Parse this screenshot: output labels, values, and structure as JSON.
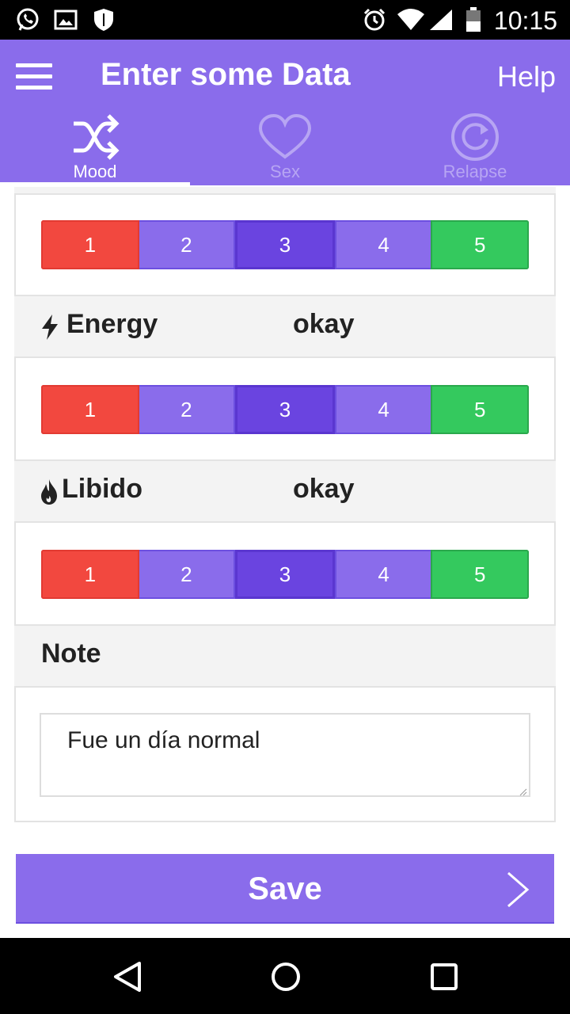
{
  "status_bar": {
    "time": "10:15",
    "icons": [
      "whatsapp-icon",
      "image-icon",
      "shield-icon",
      "alarm-icon",
      "wifi-icon",
      "signal-icon",
      "battery-icon"
    ]
  },
  "app_bar": {
    "title": "Enter some Data",
    "help": "Help",
    "menu_icon": "hamburger-menu-icon"
  },
  "tabs": [
    {
      "label": "Mood",
      "icon": "shuffle-icon",
      "active": true
    },
    {
      "label": "Sex",
      "icon": "heart-icon",
      "active": false
    },
    {
      "label": "Relapse",
      "icon": "refresh-icon",
      "active": false
    }
  ],
  "scales": [
    {
      "options": [
        "1",
        "2",
        "3",
        "4",
        "5"
      ],
      "selected": "3"
    },
    {
      "options": [
        "1",
        "2",
        "3",
        "4",
        "5"
      ],
      "selected": "3"
    },
    {
      "options": [
        "1",
        "2",
        "3",
        "4",
        "5"
      ],
      "selected": "3"
    }
  ],
  "energy": {
    "label": "Energy",
    "value": "okay",
    "icon": "lightning-icon"
  },
  "libido": {
    "label": "Libido",
    "value": "okay",
    "icon": "flame-icon"
  },
  "note": {
    "label": "Note",
    "value": "Fue un día normal"
  },
  "save": {
    "label": "Save",
    "icon": "chevron-right-icon"
  },
  "colors": {
    "accent": "#8a6ceb",
    "selected": "#6a44e0",
    "low": "#f2483f",
    "high": "#34c95e"
  },
  "nav_bar": [
    "back-icon",
    "home-icon",
    "recents-icon"
  ]
}
